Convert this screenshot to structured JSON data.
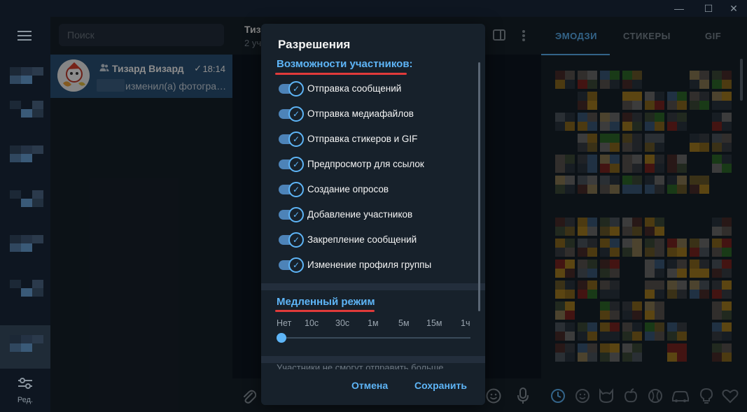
{
  "titlebar": {
    "minimize_icon": "—",
    "maximize_icon": "☐",
    "close_icon": "✕"
  },
  "folders": {
    "edit_label": "Ред."
  },
  "search": {
    "placeholder": "Поиск"
  },
  "chat": {
    "name": "Тизард Визард",
    "time": "18:14",
    "preview": "изменил(а) фотограф...",
    "read_icon": "✓"
  },
  "chat_header": {
    "title": "Тиз",
    "subtitle": "2 уч"
  },
  "side_panel": {
    "tabs": [
      "ЭМОДЗИ",
      "СТИКЕРЫ",
      "GIF"
    ],
    "active_tab": "ЭМОДЗИ"
  },
  "dialog": {
    "title": "Разрешения",
    "section_members": "Возможности участников:",
    "permissions": [
      "Отправка сообщений",
      "Отправка медиафайлов",
      "Отправка стикеров и GIF",
      "Предпросмотр для ссылок",
      "Создание опросов",
      "Добавление участников",
      "Закрепление сообщений",
      "Изменение профиля группы"
    ],
    "permissions_enabled": [
      true,
      true,
      true,
      true,
      true,
      true,
      true,
      true
    ],
    "section_slow": "Медленный режим",
    "slow_ticks": [
      "Нет",
      "10с",
      "30с",
      "1м",
      "5м",
      "15м",
      "1ч"
    ],
    "slow_selected": "Нет",
    "hint": "Участники не смогут отправить больше",
    "cancel_label": "Отмена",
    "save_label": "Сохранить"
  },
  "colors": {
    "accent": "#5eb5f7",
    "underline_mark": "#e03a3a",
    "selected_chat": "#2b5278",
    "background": "#17212b"
  }
}
